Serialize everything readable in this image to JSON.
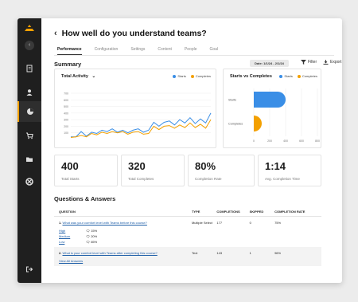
{
  "page": {
    "title": "How well do you understand teams?",
    "tabs": [
      "Performance",
      "Configuration",
      "Settings",
      "Content",
      "People",
      "Goal"
    ],
    "active_tab": "Performance"
  },
  "summary": {
    "title": "Summary",
    "date_label": "Date: 1/1/24 - 2/1/24",
    "filter_label": "Filter",
    "export_label": "Export"
  },
  "total_activity": {
    "title": "Total Activity",
    "legend": [
      "Starts",
      "Completes"
    ]
  },
  "starts_vs_completes": {
    "title": "Starts vs Completes",
    "legend": [
      "Starts",
      "Completes"
    ]
  },
  "chart_data": [
    {
      "type": "line",
      "title": "Total Activity",
      "y_ticks": [
        "700",
        "600",
        "500",
        "400",
        "300",
        "200",
        "100"
      ],
      "ylim": [
        0,
        700
      ],
      "grid": true,
      "legend_position": "top-right",
      "series": [
        {
          "name": "Starts",
          "color": "#3a8ee6",
          "values": [
            40,
            40,
            120,
            50,
            110,
            90,
            140,
            120,
            160,
            110,
            140,
            100,
            140,
            160,
            110,
            140,
            260,
            200,
            260,
            280,
            220,
            300,
            250,
            330,
            240,
            310,
            250,
            400
          ]
        },
        {
          "name": "Completes",
          "color": "#f3a000",
          "values": [
            30,
            40,
            60,
            40,
            90,
            70,
            110,
            90,
            120,
            100,
            120,
            80,
            110,
            120,
            80,
            90,
            200,
            150,
            200,
            210,
            170,
            220,
            180,
            250,
            180,
            230,
            170,
            300
          ]
        }
      ]
    },
    {
      "type": "bar",
      "orientation": "horizontal",
      "title": "Starts vs Completes",
      "categories": [
        "Starts",
        "Completes"
      ],
      "values": [
        400,
        100
      ],
      "colors": [
        "#3a8ee6",
        "#f3a000"
      ],
      "x_ticks": [
        "0",
        "200",
        "400",
        "600",
        "800"
      ],
      "xlim": [
        0,
        800
      ],
      "legend_position": "top-right"
    }
  ],
  "stats": [
    {
      "value": "400",
      "label": "Total Starts"
    },
    {
      "value": "320",
      "label": "Total Completes"
    },
    {
      "value": "80%",
      "label": "Completion Rate"
    },
    {
      "value": "1:14",
      "label": "Avg. Completion Time"
    }
  ],
  "qa": {
    "title": "Questions & Answers",
    "columns": [
      "QUESTION",
      "TYPE",
      "COMPLETIONS",
      "SKIPPED",
      "COMPLETION RATE"
    ],
    "rows": [
      {
        "num": "1.",
        "question": "What was your comfort level with Teams before this course?",
        "type": "Multiple Select",
        "completions": "177",
        "skipped": "0",
        "rate": "75%",
        "options": [
          {
            "label": "High",
            "pct": "15%"
          },
          {
            "label": "Medium",
            "pct": "20%"
          },
          {
            "label": "Low",
            "pct": "65%"
          }
        ]
      },
      {
        "num": "2.",
        "question": "What is your comfort level with Teams after completing this course?",
        "type": "Text",
        "completions": "143",
        "skipped": "1",
        "rate": "96%",
        "link": "View All Answers"
      }
    ]
  }
}
